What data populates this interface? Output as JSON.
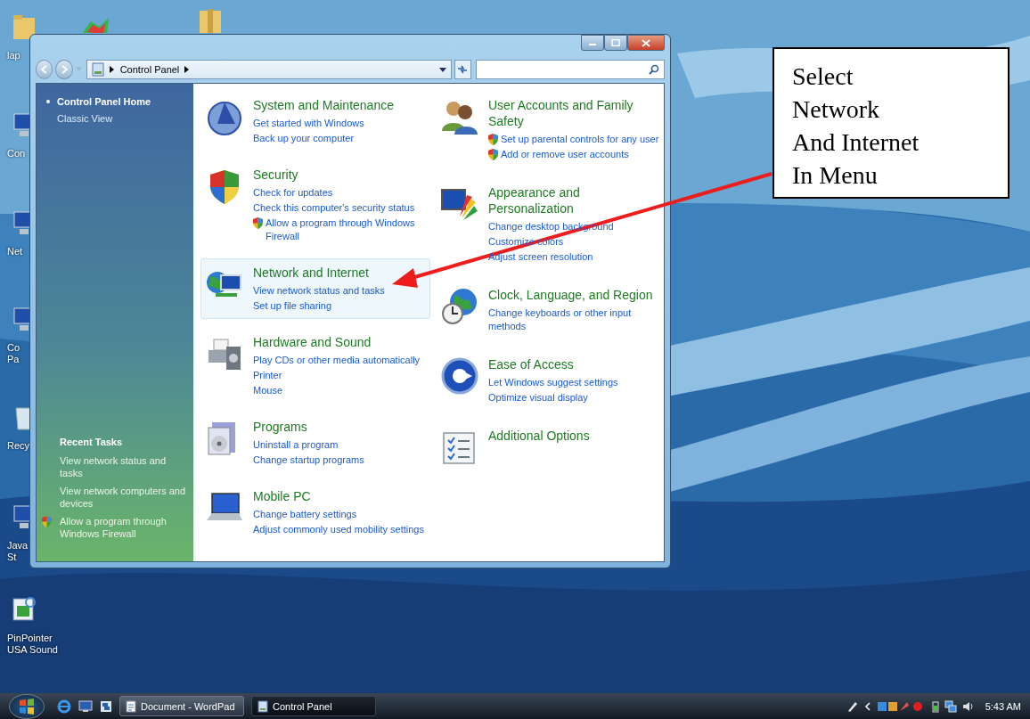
{
  "desktop_icons": [
    {
      "lines": [
        "lap"
      ]
    },
    {
      "lines": [
        "Con"
      ]
    },
    {
      "lines": [
        "Net"
      ]
    },
    {
      "lines": [
        "Co",
        "Pa"
      ]
    },
    {
      "lines": [
        "Recy"
      ]
    },
    {
      "lines": [
        "Java",
        "St"
      ]
    },
    {
      "lines": [
        "PinPointer",
        "USA Sound"
      ]
    }
  ],
  "window": {
    "address": [
      "Control Panel"
    ]
  },
  "sidebar": {
    "items": [
      {
        "label": "Control Panel Home",
        "selected": true
      },
      {
        "label": "Classic View",
        "selected": false
      }
    ],
    "recent_tasks": {
      "title": "Recent Tasks",
      "items": [
        {
          "label": "View network status and tasks",
          "shield": false
        },
        {
          "label": "View network computers and devices",
          "shield": false
        },
        {
          "label": "Allow a program through Windows Firewall",
          "shield": true
        }
      ]
    }
  },
  "categories": [
    [
      {
        "title": "System and Maintenance",
        "highlighted": false,
        "links": [
          {
            "text": "Get started with Windows",
            "shield": false
          },
          {
            "text": "Back up your computer",
            "shield": false
          }
        ]
      },
      {
        "title": "Security",
        "highlighted": false,
        "links": [
          {
            "text": "Check for updates",
            "shield": false
          },
          {
            "text": "Check this computer's security status",
            "shield": false
          },
          {
            "text": "Allow a program through Windows Firewall",
            "shield": true
          }
        ]
      },
      {
        "title": "Network and Internet",
        "highlighted": true,
        "links": [
          {
            "text": "View network status and tasks",
            "shield": false
          },
          {
            "text": "Set up file sharing",
            "shield": false
          }
        ]
      },
      {
        "title": "Hardware and Sound",
        "highlighted": false,
        "links": [
          {
            "text": "Play CDs or other media automatically",
            "shield": false
          },
          {
            "text": "Printer",
            "shield": false
          },
          {
            "text": "Mouse",
            "shield": false
          }
        ]
      },
      {
        "title": "Programs",
        "highlighted": false,
        "links": [
          {
            "text": "Uninstall a program",
            "shield": false
          },
          {
            "text": "Change startup programs",
            "shield": false
          }
        ]
      },
      {
        "title": "Mobile PC",
        "highlighted": false,
        "links": [
          {
            "text": "Change battery settings",
            "shield": false
          },
          {
            "text": "Adjust commonly used mobility settings",
            "shield": false
          }
        ]
      }
    ],
    [
      {
        "title": "User Accounts and Family Safety",
        "highlighted": false,
        "links": [
          {
            "text": "Set up parental controls for any user",
            "shield": true
          },
          {
            "text": "Add or remove user accounts",
            "shield": true
          }
        ]
      },
      {
        "title": "Appearance and Personalization",
        "highlighted": false,
        "links": [
          {
            "text": "Change desktop background",
            "shield": false
          },
          {
            "text": "Customize colors",
            "shield": false
          },
          {
            "text": "Adjust screen resolution",
            "shield": false
          }
        ]
      },
      {
        "title": "Clock, Language, and Region",
        "highlighted": false,
        "links": [
          {
            "text": "Change keyboards or other input methods",
            "shield": false
          }
        ]
      },
      {
        "title": "Ease of Access",
        "highlighted": false,
        "links": [
          {
            "text": "Let Windows suggest settings",
            "shield": false
          },
          {
            "text": "Optimize visual display",
            "shield": false
          }
        ]
      },
      {
        "title": "Additional Options",
        "highlighted": false
      }
    ]
  ],
  "callout": {
    "lines": [
      "Select",
      "Network",
      "And Internet",
      "In Menu"
    ]
  },
  "taskbar": {
    "tasks": [
      {
        "label": "Document - WordPad",
        "selected": false
      },
      {
        "label": "Control Panel",
        "selected": true
      }
    ],
    "clock": "5:43 AM"
  }
}
